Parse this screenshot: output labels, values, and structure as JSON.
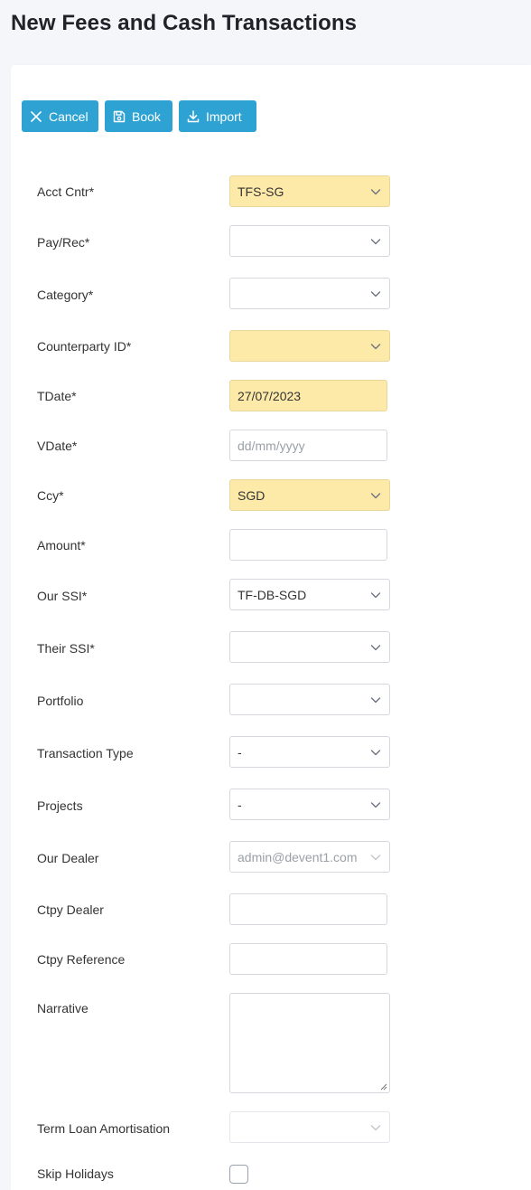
{
  "page": {
    "title": "New Fees and Cash Transactions"
  },
  "toolbar": {
    "cancel_label": "Cancel",
    "book_label": "Book",
    "import_label": "Import"
  },
  "form": {
    "acct_cntr": {
      "label": "Acct Cntr*",
      "value": "TFS-SG"
    },
    "pay_rec": {
      "label": "Pay/Rec*",
      "value": ""
    },
    "category": {
      "label": "Category*",
      "value": ""
    },
    "counterparty_id": {
      "label": "Counterparty ID*",
      "value": ""
    },
    "tdate": {
      "label": "TDate*",
      "value": "27/07/2023"
    },
    "vdate": {
      "label": "VDate*",
      "placeholder": "dd/mm/yyyy"
    },
    "ccy": {
      "label": "Ccy*",
      "value": "SGD"
    },
    "amount": {
      "label": "Amount*",
      "value": ""
    },
    "our_ssi": {
      "label": "Our SSI*",
      "value": "TF-DB-SGD"
    },
    "their_ssi": {
      "label": "Their SSI*",
      "value": ""
    },
    "portfolio": {
      "label": "Portfolio",
      "value": ""
    },
    "transaction_type": {
      "label": "Transaction Type",
      "value": "-"
    },
    "projects": {
      "label": "Projects",
      "value": "-"
    },
    "our_dealer": {
      "label": "Our Dealer",
      "value": "admin@devent1.com"
    },
    "ctpy_dealer": {
      "label": "Ctpy Dealer",
      "value": ""
    },
    "ctpy_reference": {
      "label": "Ctpy Reference",
      "value": ""
    },
    "narrative": {
      "label": "Narrative",
      "value": ""
    },
    "term_loan_amortisation": {
      "label": "Term Loan Amortisation",
      "value": ""
    },
    "skip_holidays": {
      "label": "Skip Holidays",
      "checked": false
    }
  },
  "colors": {
    "accent": "#2ea3d3",
    "required_highlight": "#fdeaa9"
  }
}
